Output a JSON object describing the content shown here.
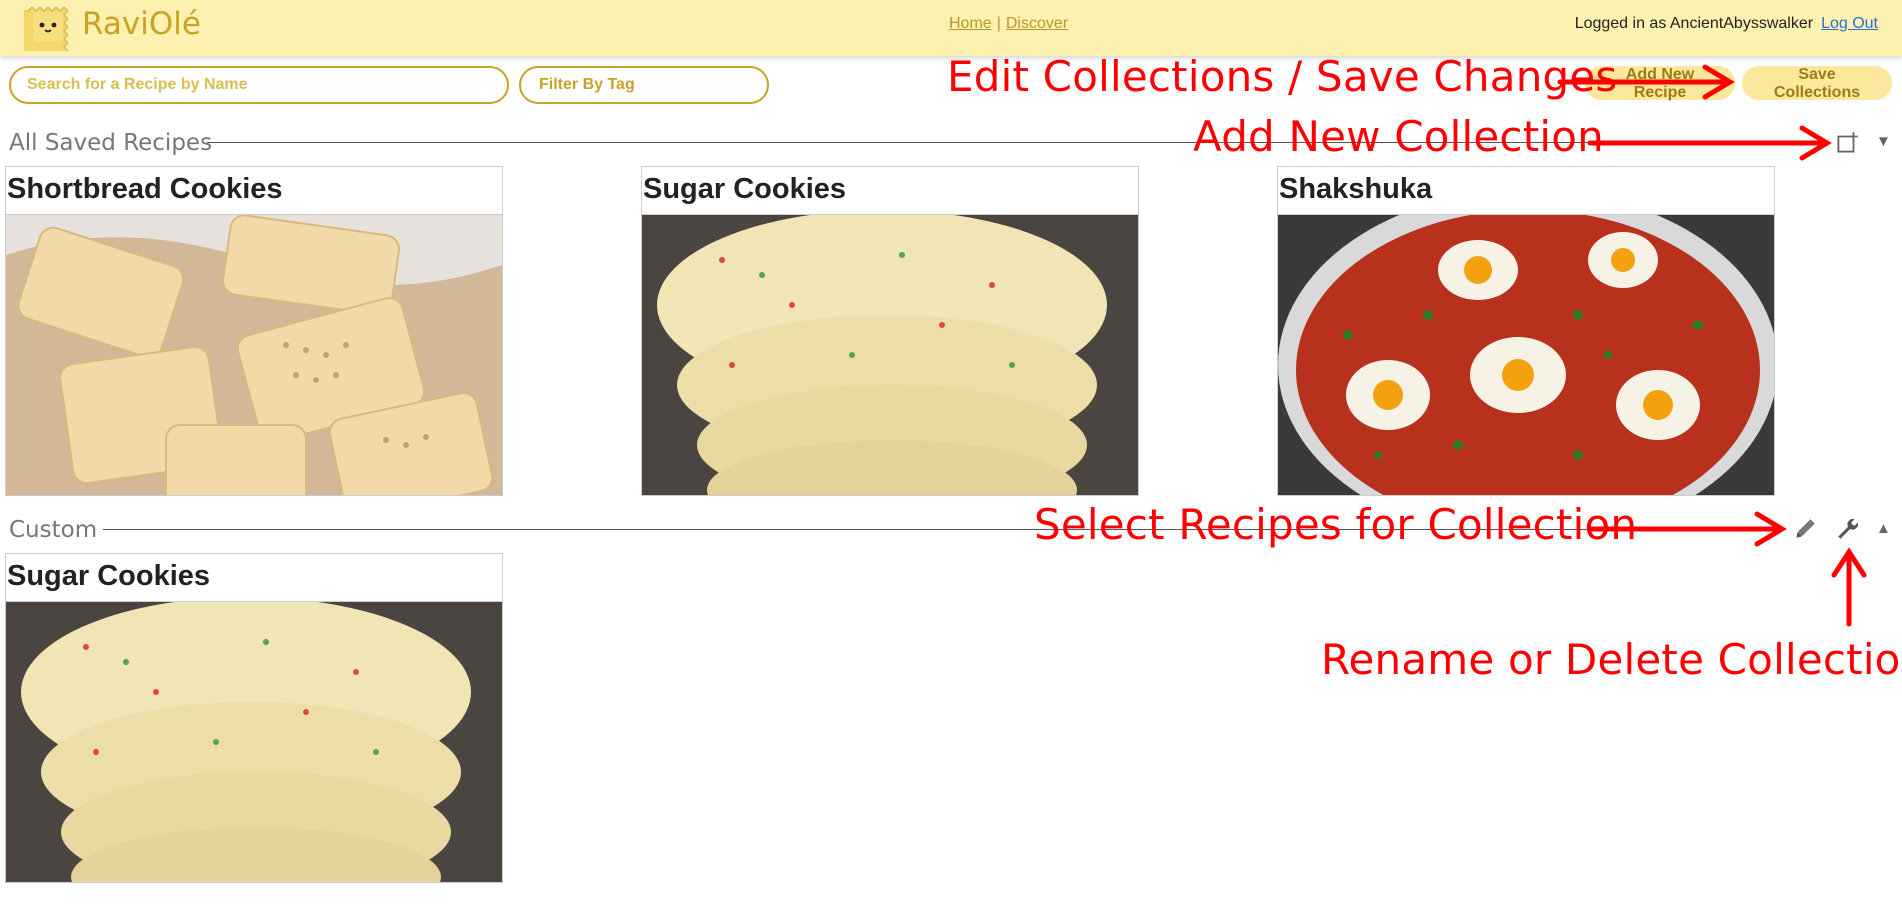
{
  "header": {
    "brand": "RaviOlé",
    "nav": {
      "home": "Home",
      "separator": "|",
      "discover": "Discover"
    },
    "logged_in_text": "Logged in as AncientAbysswalker",
    "logout": "Log Out"
  },
  "toolbar": {
    "search_placeholder": "Search for a Recipe by Name",
    "tag_placeholder": "Filter By Tag",
    "add_new_recipe": "Add New Recipe",
    "save_collections": "Save Collections"
  },
  "sections": [
    {
      "title": "All Saved Recipes",
      "recipes": [
        "Shortbread Cookies",
        "Sugar Cookies",
        "Shakshuka"
      ],
      "caret": "▼"
    },
    {
      "title": "Custom",
      "recipes": [
        "Sugar Cookies"
      ],
      "caret": "▲"
    }
  ],
  "annotations": {
    "edit_save": "Edit Collections / Save Changes",
    "add_collection": "Add New Collection",
    "select_recipes": "Select Recipes for Collection",
    "rename_delete": "Rename or Delete Collection"
  },
  "colors": {
    "header_bg": "#fdf1b0",
    "accent": "#c9a227",
    "annotation": "#ff0000"
  }
}
